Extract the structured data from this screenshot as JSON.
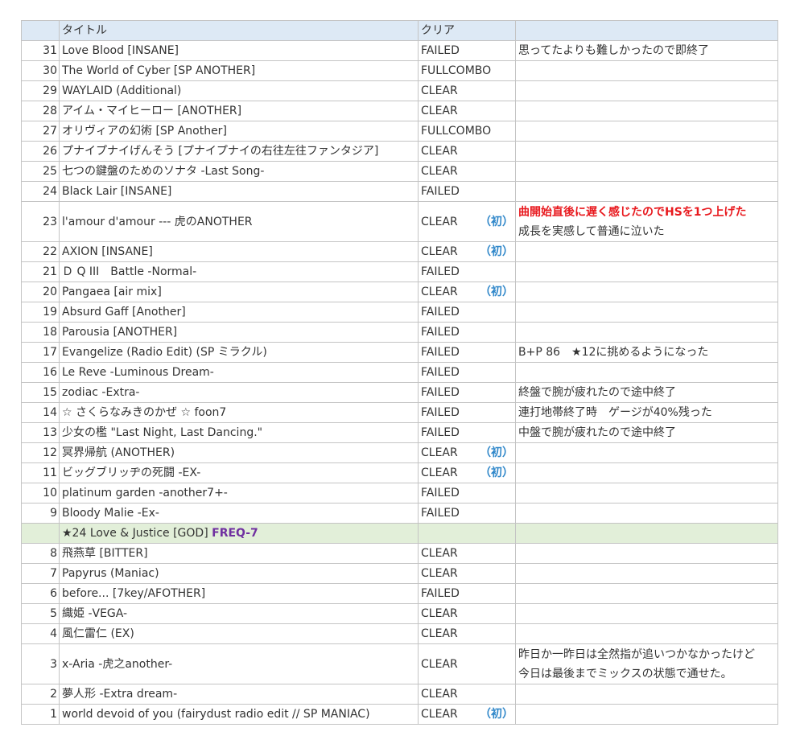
{
  "header": {
    "title": "タイトル",
    "clear": "クリア"
  },
  "first_mark": "（初）",
  "rows": [
    {
      "num": "31",
      "title": "Love Blood [INSANE]",
      "clear": "FAILED",
      "first": false,
      "note": "思ってたよりも難しかったので即終了"
    },
    {
      "num": "30",
      "title": "The World of Cyber [SP ANOTHER]",
      "clear": "FULLCOMBO",
      "first": false,
      "note": ""
    },
    {
      "num": "29",
      "title": "WAYLAID (Additional)",
      "clear": "CLEAR",
      "first": false,
      "note": ""
    },
    {
      "num": "28",
      "title": "アイム・マイヒーロー [ANOTHER]",
      "clear": "CLEAR",
      "first": false,
      "note": ""
    },
    {
      "num": "27",
      "title": "オリヴィアの幻術 [SP Another]",
      "clear": "FULLCOMBO",
      "first": false,
      "note": ""
    },
    {
      "num": "26",
      "title": "プナイプナイげんそう [プナイプナイの右往左往ファンタジア]",
      "clear": "CLEAR",
      "first": false,
      "note": ""
    },
    {
      "num": "25",
      "title": "七つの鍵盤のためのソナタ -Last Song-",
      "clear": "CLEAR",
      "first": false,
      "note": ""
    },
    {
      "num": "24",
      "title": "Black Lair [INSANE]",
      "clear": "FAILED",
      "first": false,
      "note": ""
    },
    {
      "num": "23",
      "title": "l'amour d'amour --- 虎のANOTHER",
      "clear": "CLEAR",
      "first": true,
      "note_red": "曲開始直後に遅く感じたのでHSを1つ上げた",
      "note": "成長を実感して普通に泣いた"
    },
    {
      "num": "22",
      "title": "AXION [INSANE]",
      "clear": "CLEAR",
      "first": true,
      "note": ""
    },
    {
      "num": "21",
      "title": "Ｄ Q III　Battle -Normal-",
      "clear": "FAILED",
      "first": false,
      "note": ""
    },
    {
      "num": "20",
      "title": "Pangaea [air mix]",
      "clear": "CLEAR",
      "first": true,
      "note": ""
    },
    {
      "num": "19",
      "title": "Absurd Gaff [Another]",
      "clear": "FAILED",
      "first": false,
      "note": ""
    },
    {
      "num": "18",
      "title": "Parousia [ANOTHER]",
      "clear": "FAILED",
      "first": false,
      "note": ""
    },
    {
      "num": "17",
      "title": "Evangelize (Radio Edit) (SP ミラクル)",
      "clear": "FAILED",
      "first": false,
      "note": "B+P 86　★12に挑めるようになった"
    },
    {
      "num": "16",
      "title": "Le Reve -Luminous Dream-",
      "clear": "FAILED",
      "first": false,
      "note": ""
    },
    {
      "num": "15",
      "title": "zodiac -Extra-",
      "clear": "FAILED",
      "first": false,
      "note": "終盤で腕が疲れたので途中終了"
    },
    {
      "num": "14",
      "title": "☆ さくらなみきのかぜ ☆ foon7",
      "clear": "FAILED",
      "first": false,
      "note": "連打地帯終了時　ゲージが40%残った"
    },
    {
      "num": "13",
      "title": "少女の檻 \"Last Night, Last Dancing.\"",
      "clear": "FAILED",
      "first": false,
      "note": "中盤で腕が疲れたので途中終了"
    },
    {
      "num": "12",
      "title": "冥界帰航 (ANOTHER)",
      "clear": "CLEAR",
      "first": true,
      "note": ""
    },
    {
      "num": "11",
      "title": "ビッグブリッヂの死闘 -EX-",
      "clear": "CLEAR",
      "first": true,
      "note": ""
    },
    {
      "num": "10",
      "title": "platinum garden -another7+-",
      "clear": "FAILED",
      "first": false,
      "note": ""
    },
    {
      "num": "9",
      "title": "Bloody Malie -Ex-",
      "clear": "FAILED",
      "first": false,
      "note": ""
    }
  ],
  "separator": {
    "title": "★24 Love & Justice [GOD]",
    "tag": "FREQ-7"
  },
  "rows2": [
    {
      "num": "8",
      "title": "飛燕草 [BITTER]",
      "clear": "CLEAR",
      "first": false,
      "note": ""
    },
    {
      "num": "7",
      "title": "Papyrus (Maniac)",
      "clear": "CLEAR",
      "first": false,
      "note": ""
    },
    {
      "num": "6",
      "title": "before... [7key/AFOTHER]",
      "clear": "FAILED",
      "first": false,
      "note": ""
    },
    {
      "num": "5",
      "title": "織姫 -VEGA-",
      "clear": "CLEAR",
      "first": false,
      "note": ""
    },
    {
      "num": "4",
      "title": "風仁雷仁 (EX)",
      "clear": "CLEAR",
      "first": false,
      "note": ""
    },
    {
      "num": "3",
      "title": "x-Aria -虎之another-",
      "clear": "CLEAR",
      "first": false,
      "note": "昨日か一昨日は全然指が追いつかなかったけど",
      "note2": "今日は最後までミックスの状態で通せた。"
    },
    {
      "num": "2",
      "title": "夢人形 -Extra dream-",
      "clear": "CLEAR",
      "first": false,
      "note": ""
    },
    {
      "num": "1",
      "title": "world devoid of you (fairydust radio edit // SP MANIAC)",
      "clear": "CLEAR",
      "first": true,
      "note": ""
    }
  ]
}
